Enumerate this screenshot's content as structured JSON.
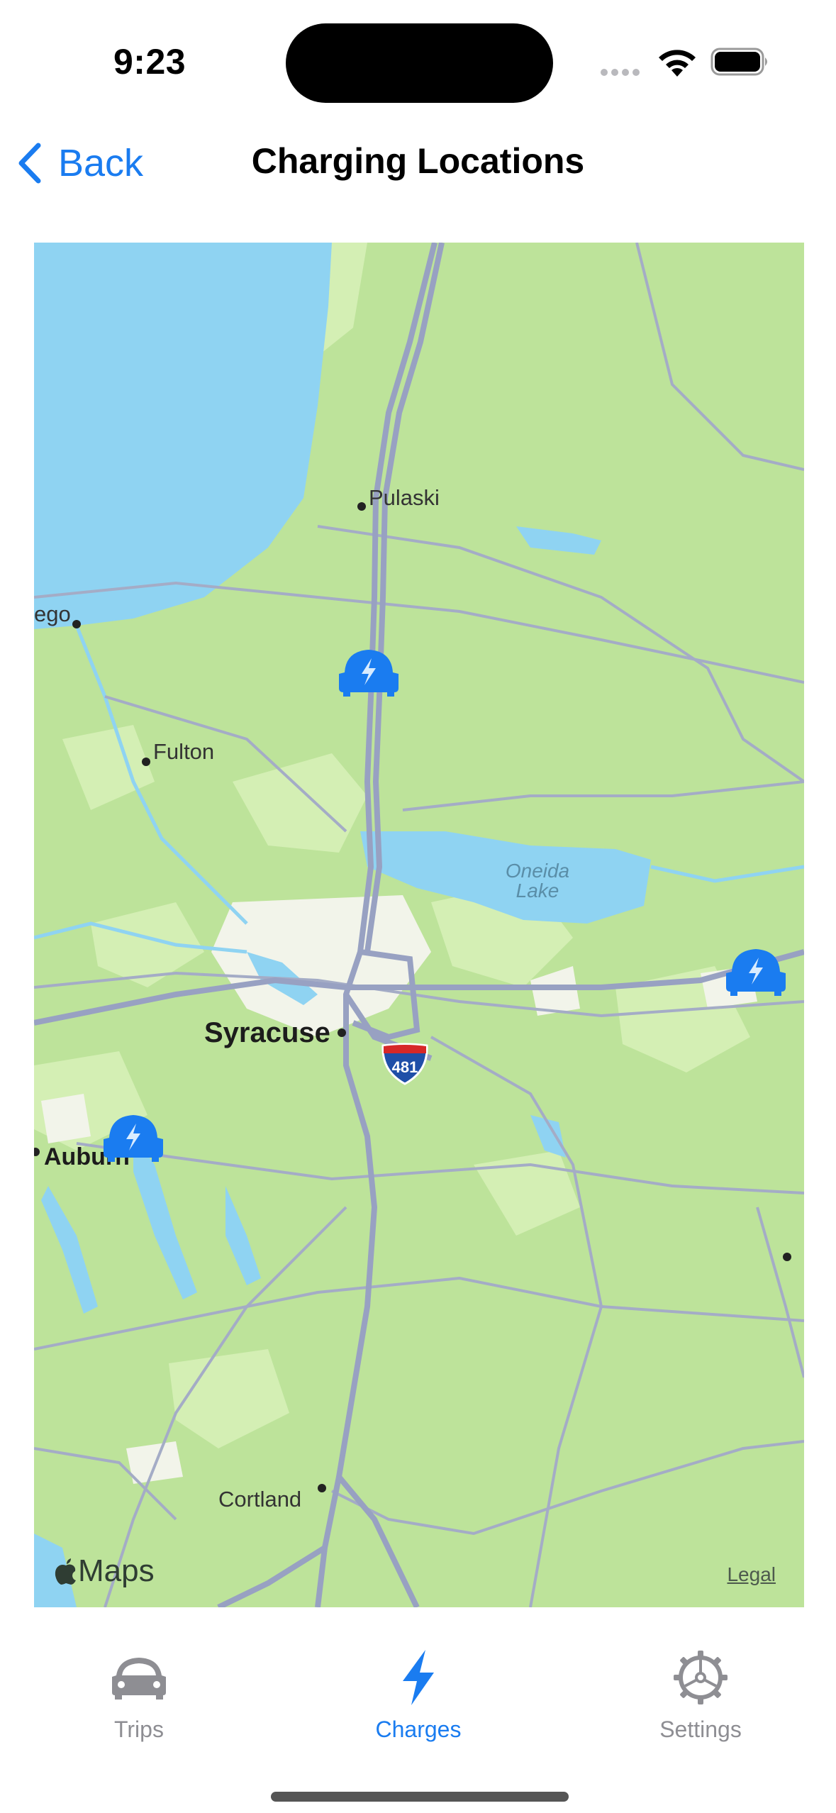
{
  "status_bar": {
    "time": "9:23"
  },
  "nav": {
    "back_label": "Back",
    "title": "Charging Locations"
  },
  "map": {
    "places": {
      "pulaski": "Pulaski",
      "oswego": "ego",
      "fulton": "Fulton",
      "syracuse": "Syracuse",
      "auburn": "Auburn",
      "cortland": "Cortland",
      "oneida_line1": "Oneida",
      "oneida_line2": "Lake"
    },
    "highway_shield": "481",
    "attribution": "Maps",
    "legal": "Legal",
    "charger_pins": [
      {
        "name": "charger-pin-pulaski",
        "icon": "ev-charger-car-icon"
      },
      {
        "name": "charger-pin-east",
        "icon": "ev-charger-car-icon"
      },
      {
        "name": "charger-pin-auburn",
        "icon": "ev-charger-car-icon"
      }
    ]
  },
  "tabs": [
    {
      "label": "Trips",
      "icon": "car-icon",
      "active": false
    },
    {
      "label": "Charges",
      "icon": "bolt-icon",
      "active": true
    },
    {
      "label": "Settings",
      "icon": "gear-icon",
      "active": false
    }
  ],
  "colors": {
    "accent": "#1a7cf0",
    "inactive": "#8e8e93",
    "land": "#bde39a",
    "water": "#8fd3f2",
    "road": "#a4acc6"
  }
}
